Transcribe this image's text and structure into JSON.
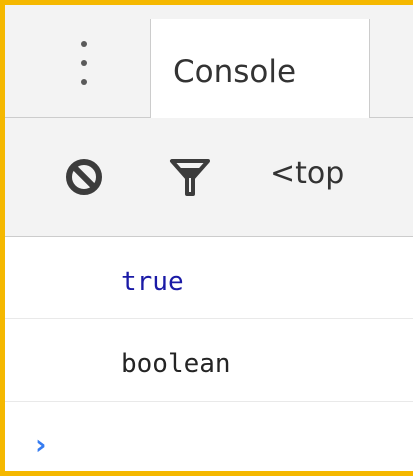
{
  "toolbar": {
    "tab_label": "Console",
    "context_label": "<top"
  },
  "console": {
    "messages": [
      {
        "text": "true",
        "color": "#1a1aa6"
      },
      {
        "text": "boolean",
        "color": "#242424"
      }
    ],
    "prompt_symbol": "›"
  },
  "icons": {
    "menu": "kebab-menu-icon",
    "clear": "clear-console-icon",
    "filter": "filter-icon"
  },
  "colors": {
    "frame_border": "#f5b800",
    "prompt_accent": "#367cf1"
  }
}
